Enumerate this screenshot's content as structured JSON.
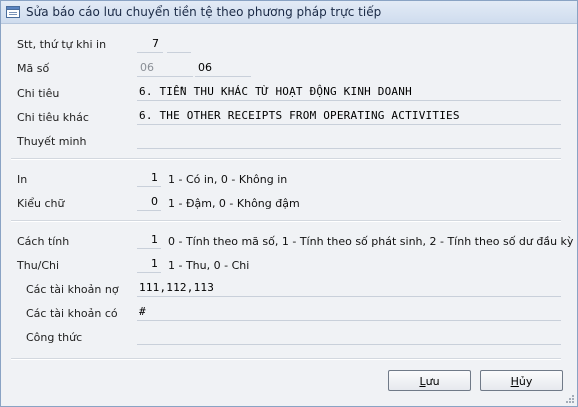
{
  "window": {
    "title": "Sửa báo cáo lưu chuyển tiền tệ theo phương pháp trực tiếp"
  },
  "form": {
    "stt_label": "Stt, thứ tự khi in",
    "stt_value": "7",
    "ma_so_label": "Mã số",
    "ma_so_old": "06",
    "ma_so_value": "06",
    "chi_tieu_label": "Chi tiêu",
    "chi_tieu_value": "6. TIỀN THU KHÁC TỪ HOẠT ĐỘNG KINH DOANH",
    "chi_tieu_khac_label": "Chi tiêu khác",
    "chi_tieu_khac_value": "6. THE OTHER RECEIPTS FROM OPERATING ACTIVITIES",
    "thuyet_minh_label": "Thuyết minh",
    "thuyet_minh_value": "",
    "in_label": "In",
    "in_value": "1",
    "in_hint": "1 - Có in, 0 - Không in",
    "kieu_chu_label": "Kiểu chữ",
    "kieu_chu_value": "0",
    "kieu_chu_hint": "1 - Đậm, 0 - Không đậm",
    "cach_tinh_label": "Cách tính",
    "cach_tinh_value": "1",
    "cach_tinh_hint": "0 - Tính theo mã số, 1 - Tính theo số phát sinh, 2 - Tính theo số dư đầu kỳ",
    "thu_chi_label": "Thu/Chi",
    "thu_chi_value": "1",
    "thu_chi_hint": "1 - Thu, 0 - Chi",
    "tk_no_label": "Các tài khoản nợ",
    "tk_no_value": "111,112,113",
    "tk_co_label": "Các tài khoản có",
    "tk_co_value": "#",
    "cong_thuc_label": "Công thức",
    "cong_thuc_value": ""
  },
  "buttons": {
    "save_first": "L",
    "save_rest": "ưu",
    "cancel_first": "H",
    "cancel_rest": "ủy"
  }
}
